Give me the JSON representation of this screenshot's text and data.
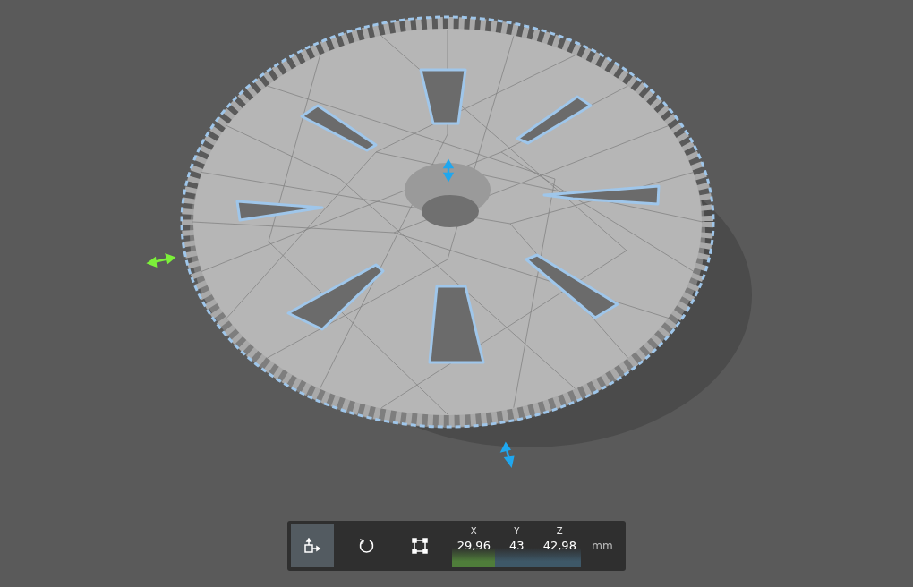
{
  "toolbar": {
    "tools": [
      {
        "kind": "move",
        "selected": true
      },
      {
        "kind": "rotate",
        "selected": false
      },
      {
        "kind": "scale",
        "selected": false
      }
    ],
    "fields": [
      {
        "label": "X",
        "value": "29,96",
        "color": "#4f7d3a"
      },
      {
        "label": "Y",
        "value": "43",
        "color": "#3e5868"
      },
      {
        "label": "Z",
        "value": "42,98",
        "color": "#3e5868"
      }
    ],
    "unit": "mm"
  }
}
